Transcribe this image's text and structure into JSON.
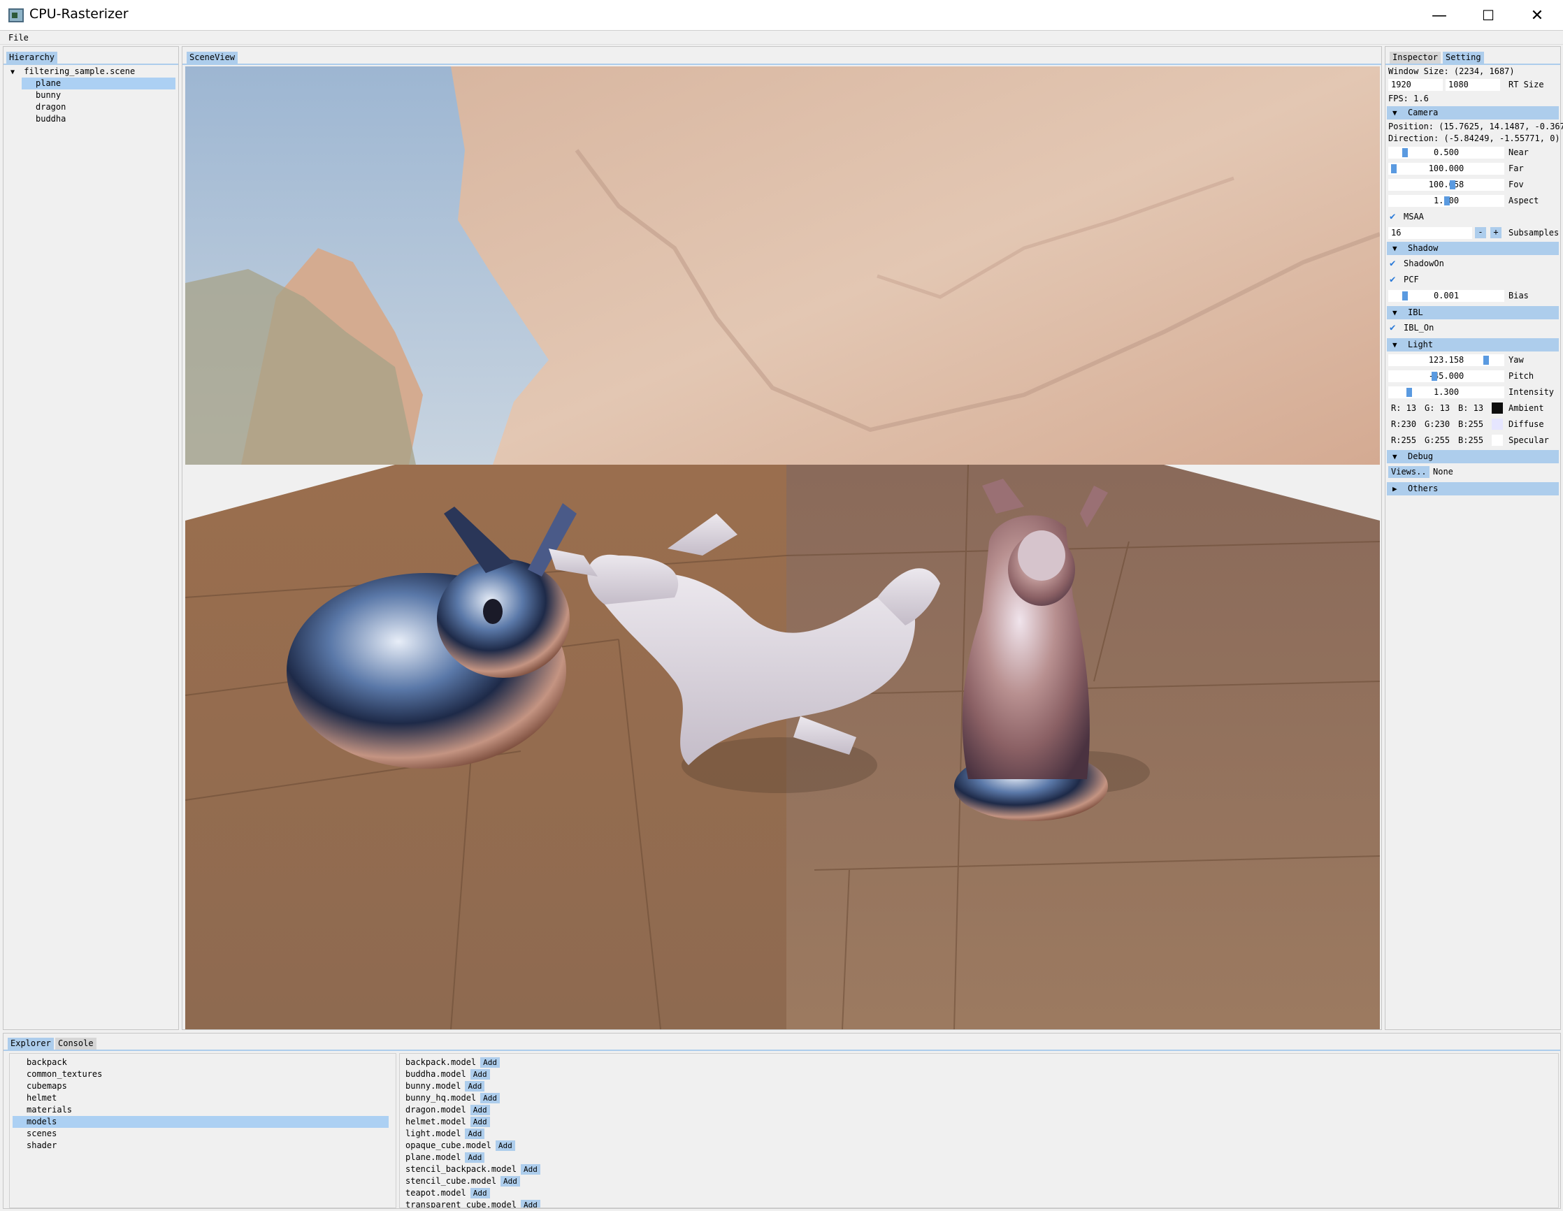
{
  "window": {
    "title": "CPU-Rasterizer",
    "minimize": "—",
    "maximize": "☐",
    "close": "✕"
  },
  "menu": {
    "file": "File"
  },
  "hierarchy": {
    "tab": "Hierarchy",
    "root": "filtering_sample.scene",
    "items": [
      "plane",
      "bunny",
      "dragon",
      "buddha"
    ],
    "selected": "plane"
  },
  "sceneview": {
    "tab": "SceneView"
  },
  "inspector": {
    "tabs": [
      "Inspector",
      "Setting"
    ],
    "window_size": "Window Size: (2234, 1687)",
    "rt_width": "1920",
    "rt_height": "1080",
    "rt_label": "RT Size",
    "fps": "FPS: 1.6",
    "camera": {
      "header": "Camera",
      "position": "Position: (15.7625, 14.1487, -0.367",
      "direction": "Direction: (-5.84249, -1.55771, 0)",
      "near": "0.500",
      "near_label": "Near",
      "far": "100.000",
      "far_label": "Far",
      "fov": "100.658",
      "fov_label": "Fov",
      "aspect": "1.000",
      "aspect_label": "Aspect",
      "msaa": "MSAA",
      "subsamples": "16",
      "subsamples_label": "Subsamples",
      "minus": "-",
      "plus": "+"
    },
    "shadow": {
      "header": "Shadow",
      "on": "ShadowOn",
      "pcf": "PCF",
      "bias": "0.001",
      "bias_label": "Bias"
    },
    "ibl": {
      "header": "IBL",
      "on": "IBL_On"
    },
    "light": {
      "header": "Light",
      "yaw": "123.158",
      "yaw_label": "Yaw",
      "pitch": "-45.000",
      "pitch_label": "Pitch",
      "intensity": "1.300",
      "intensity_label": "Intensity",
      "ambient": {
        "r": "R: 13",
        "g": "G: 13",
        "b": "B: 13",
        "label": "Ambient",
        "color": "#0d0d0d"
      },
      "diffuse": {
        "r": "R:230",
        "g": "G:230",
        "b": "B:255",
        "label": "Diffuse",
        "color": "#e6e6ff"
      },
      "specular": {
        "r": "R:255",
        "g": "G:255",
        "b": "B:255",
        "label": "Specular",
        "color": "#ffffff"
      }
    },
    "debug": {
      "header": "Debug",
      "views_button": "Views..",
      "views_value": "None"
    },
    "others": {
      "header": "Others"
    }
  },
  "explorer": {
    "tabs": [
      "Explorer",
      "Console"
    ],
    "folders": [
      "backpack",
      "common_textures",
      "cubemaps",
      "helmet",
      "materials",
      "models",
      "scenes",
      "shader"
    ],
    "selected_folder": "models",
    "files": [
      "backpack.model",
      "buddha.model",
      "bunny.model",
      "bunny_hq.model",
      "dragon.model",
      "helmet.model",
      "light.model",
      "opaque_cube.model",
      "plane.model",
      "stencil_backpack.model",
      "stencil_cube.model",
      "teapot.model",
      "transparent_cube.model"
    ],
    "add_label": "Add"
  },
  "colors": {
    "accent": "#adcdec",
    "selected": "#acd0f3",
    "slider_grab": "#5a9ae0"
  }
}
